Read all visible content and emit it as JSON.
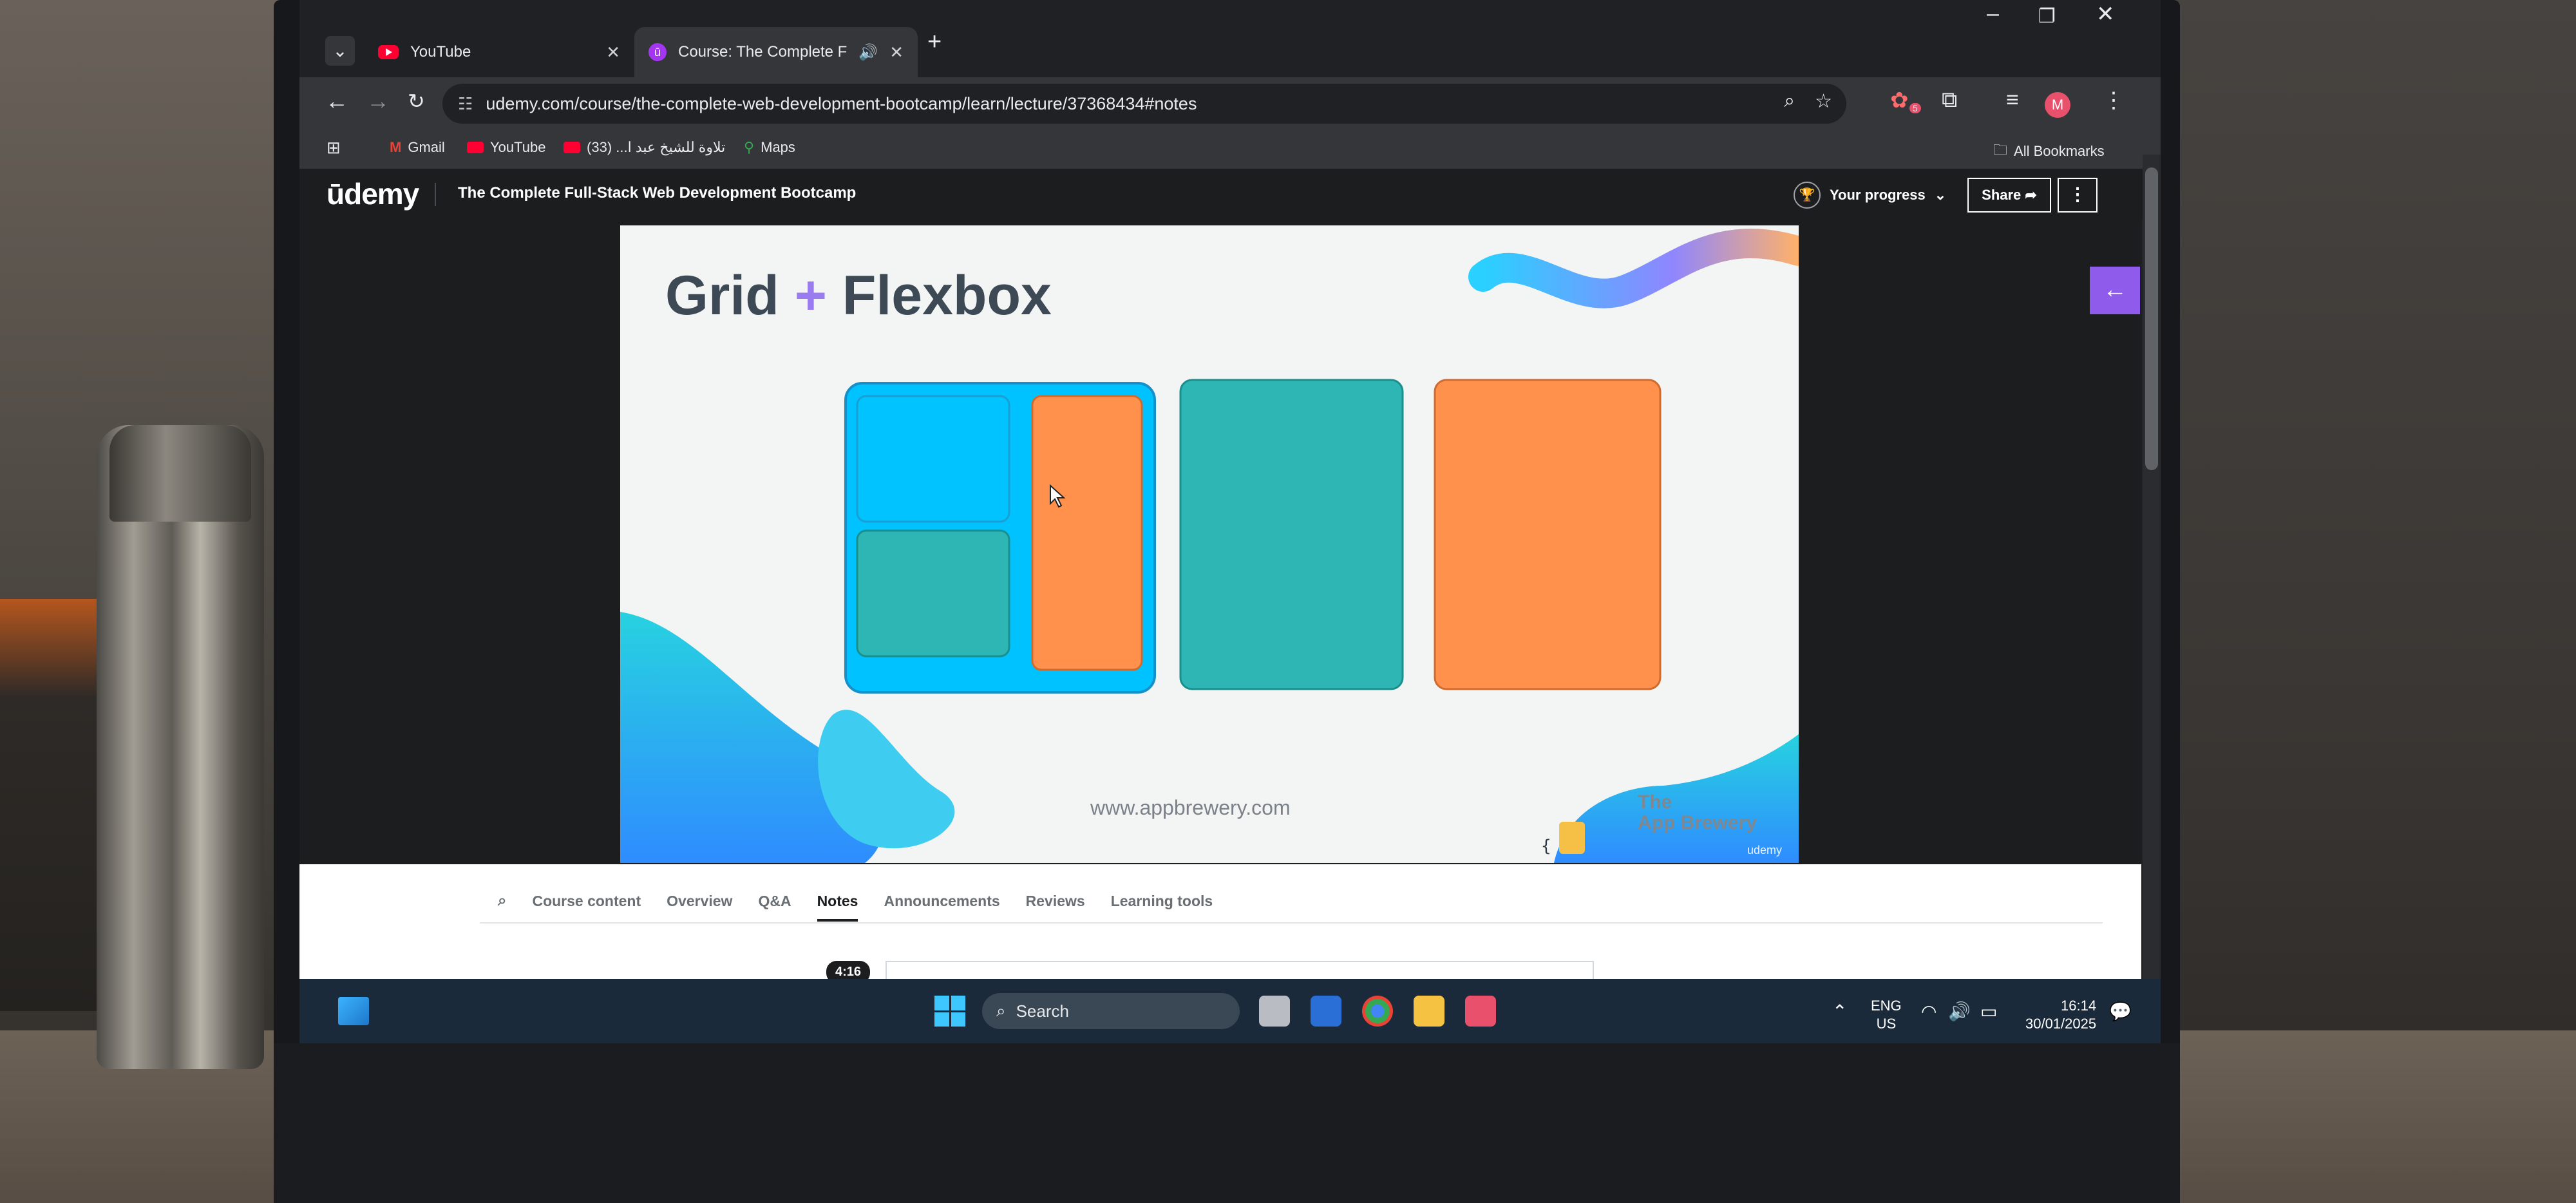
{
  "browser": {
    "tabs": [
      {
        "title": "YouTube",
        "active": false
      },
      {
        "title": "Course: The Complete Full-",
        "active": true
      }
    ],
    "address": "udemy.com/course/the-complete-web-development-bootcamp/learn/lecture/37368434#notes",
    "bookmarks": [
      {
        "label": "Gmail"
      },
      {
        "label": "YouTube"
      },
      {
        "label": "تلاوة للشيخ عبد ا... (33)"
      },
      {
        "label": "Maps"
      }
    ],
    "all_bookmarks": "All Bookmarks",
    "avatar_letter": "M",
    "extension_badge": "5"
  },
  "udemy": {
    "logo": "ūdemy",
    "course_title": "The Complete Full-Stack Web Development Bootcamp",
    "progress_label": "Your progress",
    "share_label": "Share",
    "slide": {
      "title_left": "Grid",
      "title_plus": "+",
      "title_right": "Flexbox",
      "url": "www.appbrewery.com",
      "brand_line1": "The",
      "brand_line2": "App Brewery",
      "watermark": "udemy"
    },
    "tabs": [
      "Course content",
      "Overview",
      "Q&A",
      "Notes",
      "Announcements",
      "Reviews",
      "Learning tools"
    ],
    "active_tab": "Notes",
    "timestamp": "4:16"
  },
  "taskbar": {
    "search_placeholder": "Search",
    "lang_line1": "ENG",
    "lang_line2": "US",
    "time": "16:14",
    "date": "30/01/2025"
  },
  "colors": {
    "udemy_purple": "#a435f0",
    "slide_cyan": "#00c3ff",
    "slide_teal": "#2db6b4",
    "slide_orange": "#ff914d"
  }
}
